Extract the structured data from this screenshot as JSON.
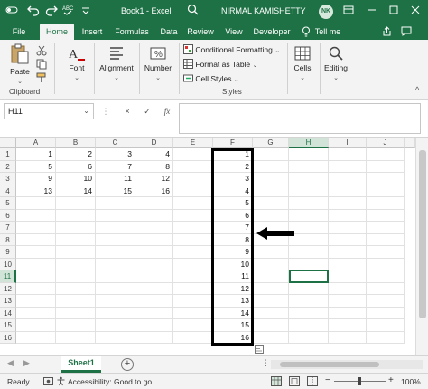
{
  "titlebar": {
    "title": "Book1  -  Excel",
    "user": "NIRMAL KAMISHETTY",
    "avatar_initials": "NK",
    "icons": [
      "autosave-icon",
      "undo-icon",
      "redo-icon",
      "customize-icon",
      "search-icon",
      "ribbon-display-icon",
      "minimize-icon",
      "maximize-icon",
      "close-icon"
    ]
  },
  "tabs": [
    {
      "label": "File"
    },
    {
      "label": "Home",
      "active": true
    },
    {
      "label": "Insert"
    },
    {
      "label": "Formulas"
    },
    {
      "label": "Data"
    },
    {
      "label": "Review"
    },
    {
      "label": "View"
    },
    {
      "label": "Developer"
    },
    {
      "label": "Tell me"
    }
  ],
  "ribbon": {
    "paste_label": "Paste",
    "clipboard_label": "Clipboard",
    "font_label": "Font",
    "alignment_label": "Alignment",
    "number_label": "Number",
    "conditional_formatting": "Conditional Formatting",
    "format_as_table": "Format as Table",
    "cell_styles": "Cell Styles",
    "styles_label": "Styles",
    "cells_label": "Cells",
    "editing_label": "Editing",
    "chevron": "⌄",
    "collapse": "^"
  },
  "formula_bar": {
    "name_box": "H11",
    "fx": "fx",
    "cancel": "×",
    "enter": "✓",
    "colon": "⋮",
    "formula": ""
  },
  "grid": {
    "columns": [
      "A",
      "B",
      "C",
      "D",
      "E",
      "F",
      "G",
      "H",
      "I",
      "J"
    ],
    "selected_column": "H",
    "rows": [
      "1",
      "2",
      "3",
      "4",
      "5",
      "6",
      "7",
      "8",
      "9",
      "10",
      "11",
      "12",
      "13",
      "14",
      "15",
      "16"
    ],
    "selected_row": "11",
    "cells": {
      "A": [
        "1",
        "5",
        "9",
        "13"
      ],
      "B": [
        "2",
        "6",
        "10",
        "14"
      ],
      "C": [
        "3",
        "7",
        "11",
        "15"
      ],
      "D": [
        "4",
        "8",
        "12",
        "16"
      ],
      "F": [
        "1",
        "2",
        "3",
        "4",
        "5",
        "6",
        "7",
        "8",
        "9",
        "10",
        "11",
        "12",
        "13",
        "14",
        "15",
        "16"
      ]
    }
  },
  "sheets": {
    "active": "Sheet1",
    "add": "+",
    "prev": "◀",
    "next": "▶",
    "more": "⋮"
  },
  "status": {
    "ready": "Ready",
    "accessibility": "Accessibility: Good to go",
    "zoom": "100%",
    "zoom_minus": "−",
    "zoom_plus": "+"
  },
  "colors": {
    "excel_green": "#1e7145",
    "annotation_black": "#000000"
  }
}
